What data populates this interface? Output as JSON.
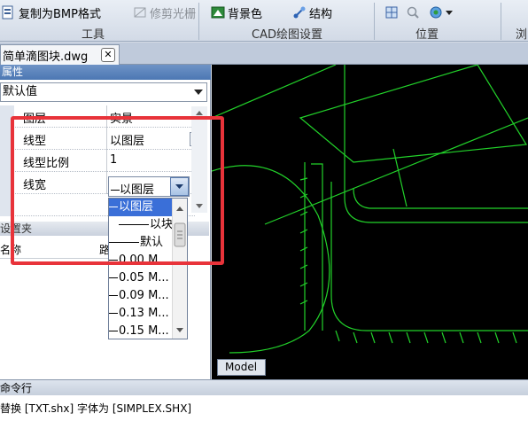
{
  "ribbon": {
    "copy_bmp_label": "复制为BMP格式",
    "trim_raster_label": "修剪光栅",
    "background_label": "背景色",
    "structure_label": "结构",
    "group_tools": "工具",
    "group_cad_settings": "CAD绘图设置",
    "group_position": "位置",
    "group_browse_partial": "浏"
  },
  "document_tab": {
    "filename": "简单滴图块.dwg",
    "close_glyph": "✕"
  },
  "properties": {
    "title": "属性",
    "selector_value": "默认值",
    "rows": [
      {
        "name": "图层",
        "value": "实景"
      },
      {
        "name": "线型",
        "value": "以图层"
      },
      {
        "name": "线型比例",
        "value": "1"
      },
      {
        "name": "线宽",
        "value": "以图层"
      }
    ]
  },
  "lineweight_options": [
    "以图层",
    "以块",
    "默认",
    "0.00 M...",
    "0.05 M...",
    "0.09 M...",
    "0.13 M...",
    "0.15 M..."
  ],
  "lower_panel": {
    "header": "设置夹",
    "col_name": "名称",
    "col_path": "路"
  },
  "canvas": {
    "model_tab": "Model"
  },
  "command": {
    "header": "命令行",
    "line": "替换 [TXT.shx] 字体为 [SIMPLEX.SHX]"
  },
  "colors": {
    "highlight": "#e8333a",
    "cad_lines": "#22d22a",
    "selection": "#3a6fd8"
  }
}
